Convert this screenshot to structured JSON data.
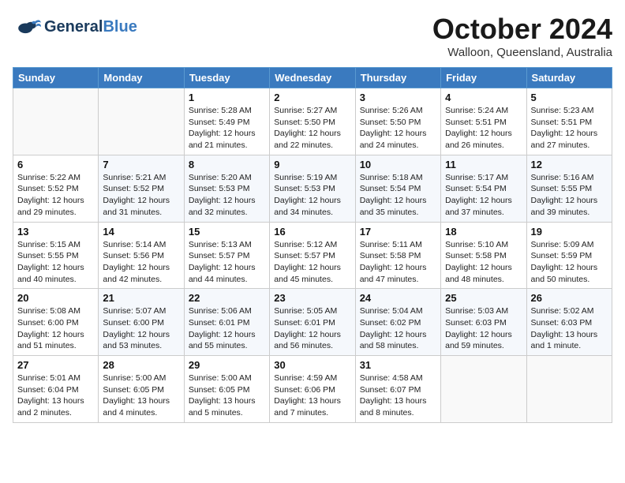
{
  "header": {
    "logo_line1": "General",
    "logo_line2": "Blue",
    "month_title": "October 2024",
    "location": "Walloon, Queensland, Australia"
  },
  "weekdays": [
    "Sunday",
    "Monday",
    "Tuesday",
    "Wednesday",
    "Thursday",
    "Friday",
    "Saturday"
  ],
  "weeks": [
    [
      {
        "day": "",
        "sunrise": "",
        "sunset": "",
        "daylight": ""
      },
      {
        "day": "",
        "sunrise": "",
        "sunset": "",
        "daylight": ""
      },
      {
        "day": "1",
        "sunrise": "Sunrise: 5:28 AM",
        "sunset": "Sunset: 5:49 PM",
        "daylight": "Daylight: 12 hours and 21 minutes."
      },
      {
        "day": "2",
        "sunrise": "Sunrise: 5:27 AM",
        "sunset": "Sunset: 5:50 PM",
        "daylight": "Daylight: 12 hours and 22 minutes."
      },
      {
        "day": "3",
        "sunrise": "Sunrise: 5:26 AM",
        "sunset": "Sunset: 5:50 PM",
        "daylight": "Daylight: 12 hours and 24 minutes."
      },
      {
        "day": "4",
        "sunrise": "Sunrise: 5:24 AM",
        "sunset": "Sunset: 5:51 PM",
        "daylight": "Daylight: 12 hours and 26 minutes."
      },
      {
        "day": "5",
        "sunrise": "Sunrise: 5:23 AM",
        "sunset": "Sunset: 5:51 PM",
        "daylight": "Daylight: 12 hours and 27 minutes."
      }
    ],
    [
      {
        "day": "6",
        "sunrise": "Sunrise: 5:22 AM",
        "sunset": "Sunset: 5:52 PM",
        "daylight": "Daylight: 12 hours and 29 minutes."
      },
      {
        "day": "7",
        "sunrise": "Sunrise: 5:21 AM",
        "sunset": "Sunset: 5:52 PM",
        "daylight": "Daylight: 12 hours and 31 minutes."
      },
      {
        "day": "8",
        "sunrise": "Sunrise: 5:20 AM",
        "sunset": "Sunset: 5:53 PM",
        "daylight": "Daylight: 12 hours and 32 minutes."
      },
      {
        "day": "9",
        "sunrise": "Sunrise: 5:19 AM",
        "sunset": "Sunset: 5:53 PM",
        "daylight": "Daylight: 12 hours and 34 minutes."
      },
      {
        "day": "10",
        "sunrise": "Sunrise: 5:18 AM",
        "sunset": "Sunset: 5:54 PM",
        "daylight": "Daylight: 12 hours and 35 minutes."
      },
      {
        "day": "11",
        "sunrise": "Sunrise: 5:17 AM",
        "sunset": "Sunset: 5:54 PM",
        "daylight": "Daylight: 12 hours and 37 minutes."
      },
      {
        "day": "12",
        "sunrise": "Sunrise: 5:16 AM",
        "sunset": "Sunset: 5:55 PM",
        "daylight": "Daylight: 12 hours and 39 minutes."
      }
    ],
    [
      {
        "day": "13",
        "sunrise": "Sunrise: 5:15 AM",
        "sunset": "Sunset: 5:55 PM",
        "daylight": "Daylight: 12 hours and 40 minutes."
      },
      {
        "day": "14",
        "sunrise": "Sunrise: 5:14 AM",
        "sunset": "Sunset: 5:56 PM",
        "daylight": "Daylight: 12 hours and 42 minutes."
      },
      {
        "day": "15",
        "sunrise": "Sunrise: 5:13 AM",
        "sunset": "Sunset: 5:57 PM",
        "daylight": "Daylight: 12 hours and 44 minutes."
      },
      {
        "day": "16",
        "sunrise": "Sunrise: 5:12 AM",
        "sunset": "Sunset: 5:57 PM",
        "daylight": "Daylight: 12 hours and 45 minutes."
      },
      {
        "day": "17",
        "sunrise": "Sunrise: 5:11 AM",
        "sunset": "Sunset: 5:58 PM",
        "daylight": "Daylight: 12 hours and 47 minutes."
      },
      {
        "day": "18",
        "sunrise": "Sunrise: 5:10 AM",
        "sunset": "Sunset: 5:58 PM",
        "daylight": "Daylight: 12 hours and 48 minutes."
      },
      {
        "day": "19",
        "sunrise": "Sunrise: 5:09 AM",
        "sunset": "Sunset: 5:59 PM",
        "daylight": "Daylight: 12 hours and 50 minutes."
      }
    ],
    [
      {
        "day": "20",
        "sunrise": "Sunrise: 5:08 AM",
        "sunset": "Sunset: 6:00 PM",
        "daylight": "Daylight: 12 hours and 51 minutes."
      },
      {
        "day": "21",
        "sunrise": "Sunrise: 5:07 AM",
        "sunset": "Sunset: 6:00 PM",
        "daylight": "Daylight: 12 hours and 53 minutes."
      },
      {
        "day": "22",
        "sunrise": "Sunrise: 5:06 AM",
        "sunset": "Sunset: 6:01 PM",
        "daylight": "Daylight: 12 hours and 55 minutes."
      },
      {
        "day": "23",
        "sunrise": "Sunrise: 5:05 AM",
        "sunset": "Sunset: 6:01 PM",
        "daylight": "Daylight: 12 hours and 56 minutes."
      },
      {
        "day": "24",
        "sunrise": "Sunrise: 5:04 AM",
        "sunset": "Sunset: 6:02 PM",
        "daylight": "Daylight: 12 hours and 58 minutes."
      },
      {
        "day": "25",
        "sunrise": "Sunrise: 5:03 AM",
        "sunset": "Sunset: 6:03 PM",
        "daylight": "Daylight: 12 hours and 59 minutes."
      },
      {
        "day": "26",
        "sunrise": "Sunrise: 5:02 AM",
        "sunset": "Sunset: 6:03 PM",
        "daylight": "Daylight: 13 hours and 1 minute."
      }
    ],
    [
      {
        "day": "27",
        "sunrise": "Sunrise: 5:01 AM",
        "sunset": "Sunset: 6:04 PM",
        "daylight": "Daylight: 13 hours and 2 minutes."
      },
      {
        "day": "28",
        "sunrise": "Sunrise: 5:00 AM",
        "sunset": "Sunset: 6:05 PM",
        "daylight": "Daylight: 13 hours and 4 minutes."
      },
      {
        "day": "29",
        "sunrise": "Sunrise: 5:00 AM",
        "sunset": "Sunset: 6:05 PM",
        "daylight": "Daylight: 13 hours and 5 minutes."
      },
      {
        "day": "30",
        "sunrise": "Sunrise: 4:59 AM",
        "sunset": "Sunset: 6:06 PM",
        "daylight": "Daylight: 13 hours and 7 minutes."
      },
      {
        "day": "31",
        "sunrise": "Sunrise: 4:58 AM",
        "sunset": "Sunset: 6:07 PM",
        "daylight": "Daylight: 13 hours and 8 minutes."
      },
      {
        "day": "",
        "sunrise": "",
        "sunset": "",
        "daylight": ""
      },
      {
        "day": "",
        "sunrise": "",
        "sunset": "",
        "daylight": ""
      }
    ]
  ]
}
